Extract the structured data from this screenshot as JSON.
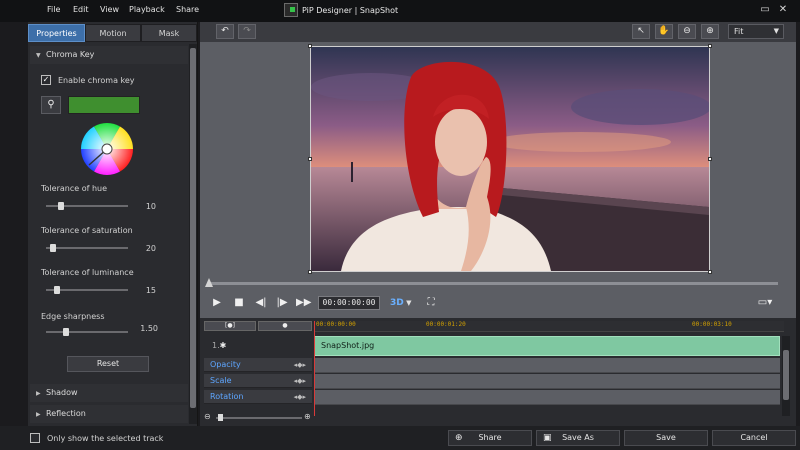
{
  "app": {
    "menu": [
      "File",
      "Edit",
      "View",
      "Playback",
      "Share"
    ],
    "title": "PiP Designer | SnapShot"
  },
  "left_panel": {
    "tabs": [
      {
        "label": "Properties",
        "active": true
      },
      {
        "label": "Motion",
        "active": false
      },
      {
        "label": "Mask",
        "active": false
      }
    ],
    "chroma_key": {
      "section_label": "Chroma Key",
      "enable_label": "Enable chroma key",
      "enabled": true,
      "key_color": "#3f8f2f",
      "sliders": [
        {
          "label": "Tolerance of hue",
          "value": "10",
          "fraction": 0.18
        },
        {
          "label": "Tolerance of saturation",
          "value": "20",
          "fraction": 0.09
        },
        {
          "label": "Tolerance of luminance",
          "value": "15",
          "fraction": 0.14
        },
        {
          "label": "Edge sharpness",
          "value": "1.50",
          "fraction": 0.24
        }
      ],
      "reset_label": "Reset"
    },
    "sections": [
      "Shadow",
      "Reflection"
    ]
  },
  "preview": {
    "fit_label": "Fit",
    "timecode": "00:00:00:00",
    "mode_3d": "3D"
  },
  "timeline": {
    "ruler_marks": [
      "00:00:00:00",
      "00:00:01:20",
      "00:00:03:10"
    ],
    "track_number": "1.",
    "clip_name": "SnapShot.jpg",
    "tracks": [
      "Opacity",
      "Scale",
      "Rotation"
    ]
  },
  "bottom": {
    "only_selected_label": "Only show the selected track",
    "share_label": "Share",
    "save_as_label": "Save As",
    "save_label": "Save",
    "cancel_label": "Cancel"
  },
  "colors": {
    "accent": "#3d6fa9",
    "clip": "#7fc8a1",
    "track_label": "#5ea6ff",
    "timecode_mark": "#d4a200"
  }
}
